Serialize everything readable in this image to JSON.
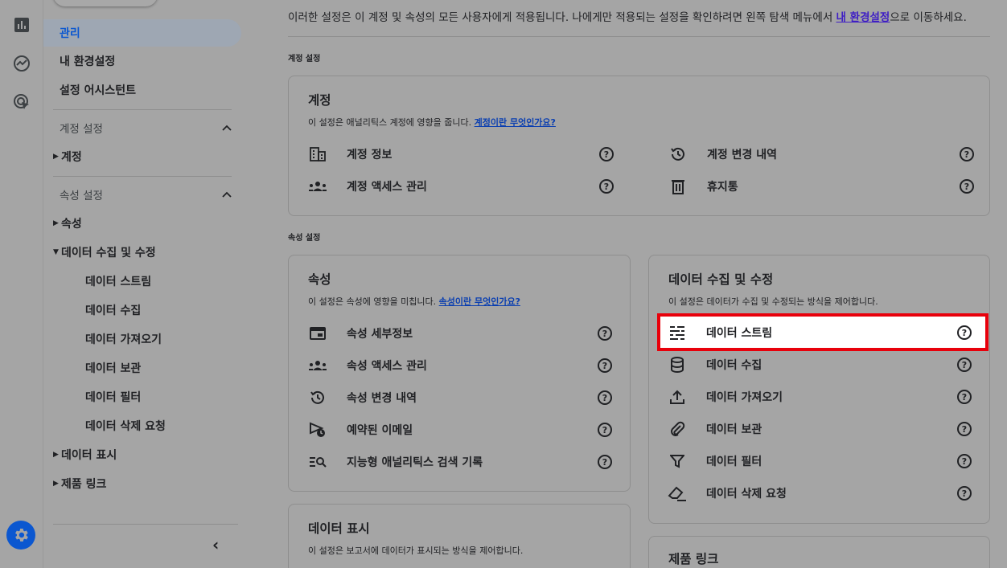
{
  "sidebar": {
    "admin": "관리",
    "my_prefs": "내 환경설정",
    "setup_assistant": "설정 어시스턴트",
    "account_settings": "계정 설정",
    "account": "계정",
    "property_settings": "속성 설정",
    "property": "속성",
    "data_collection": "데이터 수집 및 수정",
    "sub": [
      "데이터 스트림",
      "데이터 수집",
      "데이터 가져오기",
      "데이터 보관",
      "데이터 필터",
      "데이터 삭제 요청"
    ],
    "data_display": "데이터 표시",
    "product_links": "제품 링크",
    "collapse": "‹"
  },
  "intro": {
    "text_before": "이러한 설정은 이 계정 및 속성의 모든 사용자에게 적용됩니다. 나에게만 적용되는 설정을 확인하려면 왼쪽 탐색 메뉴에서 ",
    "link": "내 환경설정",
    "text_after": "으로 이동하세요."
  },
  "labels": {
    "account_section": "계정 설정",
    "property_section": "속성 설정"
  },
  "cards": {
    "account": {
      "title": "계정",
      "desc": "이 설정은 애널리틱스 계정에 영향을 줍니다. ",
      "link": "계정이란 무엇인가요?",
      "items": [
        "계정 정보",
        "계정 액세스 관리",
        "계정 변경 내역",
        "휴지통"
      ]
    },
    "property": {
      "title": "속성",
      "desc": "이 설정은 속성에 영향을 미칩니다. ",
      "link": "속성이란 무엇인가요?",
      "items": [
        "속성 세부정보",
        "속성 액세스 관리",
        "속성 변경 내역",
        "예약된 이메일",
        "지능형 애널리틱스 검색 기록"
      ]
    },
    "data_collection": {
      "title": "데이터 수집 및 수정",
      "desc": "이 설정은 데이터가 수집 및 수정되는 방식을 제어합니다.",
      "items": [
        "데이터 스트림",
        "데이터 수집",
        "데이터 가져오기",
        "데이터 보관",
        "데이터 필터",
        "데이터 삭제 요청"
      ]
    },
    "data_display": {
      "title": "데이터 표시",
      "desc": "이 설정은 보고서에 데이터가 표시되는 방식을 제어합니다."
    },
    "product_links": {
      "title": "제품 링크"
    }
  },
  "help_glyph": "?",
  "colors": {
    "accent": "#0b57d0",
    "highlight": "#e8000b"
  }
}
